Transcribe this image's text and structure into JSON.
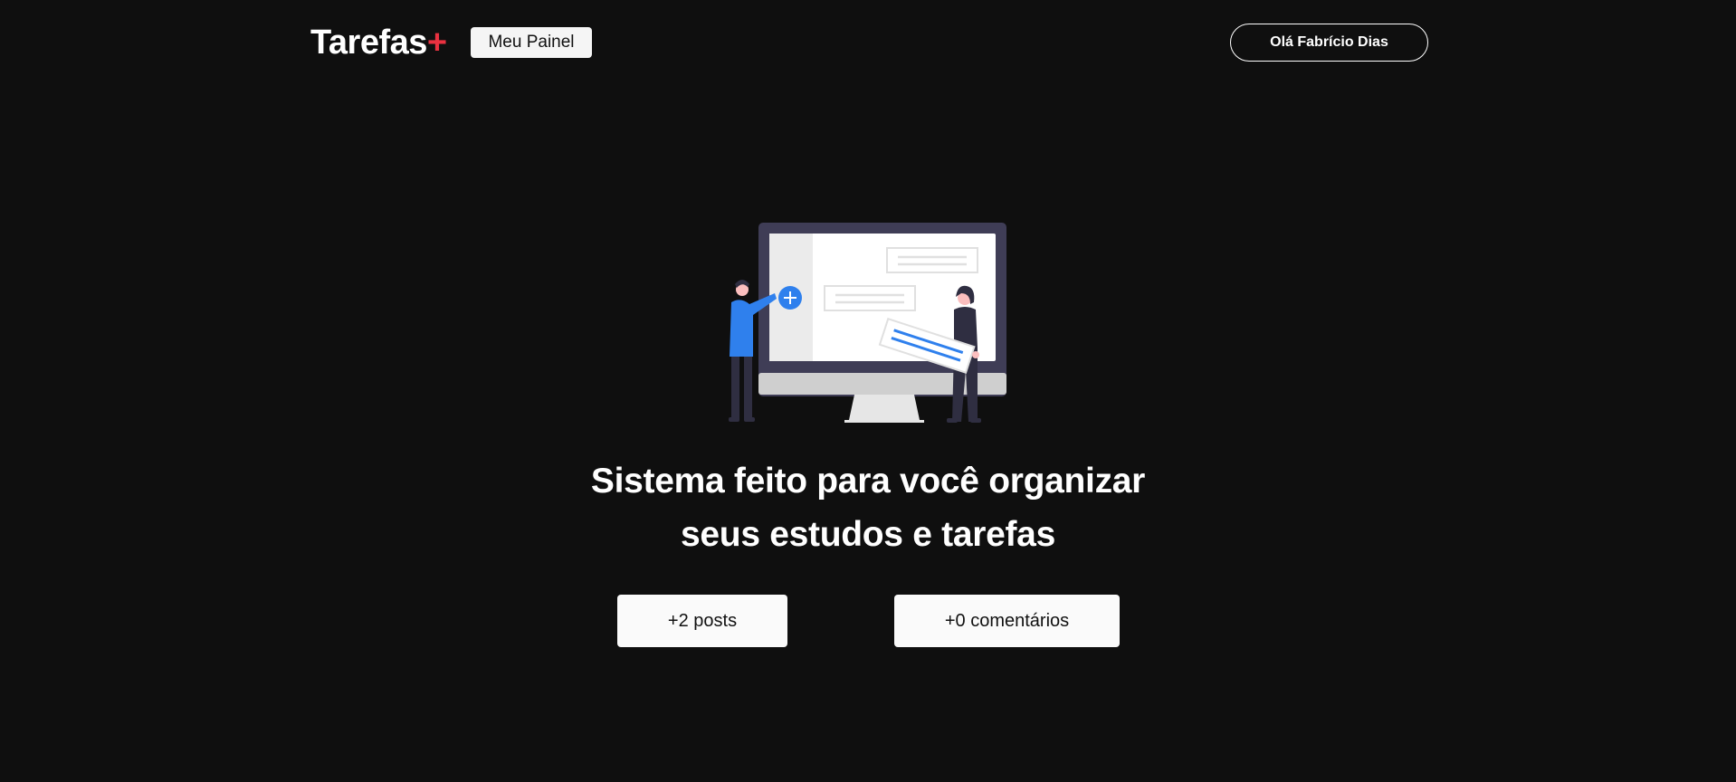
{
  "header": {
    "logo_text": "Tarefas",
    "logo_accent": "+",
    "panel_button": "Meu Painel",
    "user_greeting": "Olá Fabrício Dias"
  },
  "hero": {
    "illustration_icon": "people-with-monitor-illustration",
    "title_line1": "Sistema feito para você organizar",
    "title_line2": "seus estudos e tarefas"
  },
  "stats": {
    "posts": "+2 posts",
    "comments": "+0 comentários"
  },
  "colors": {
    "background": "#0f0f0f",
    "accent": "#ea3140",
    "illustration_blue": "#2f80ed",
    "monitor_frame": "#3f3d56"
  }
}
